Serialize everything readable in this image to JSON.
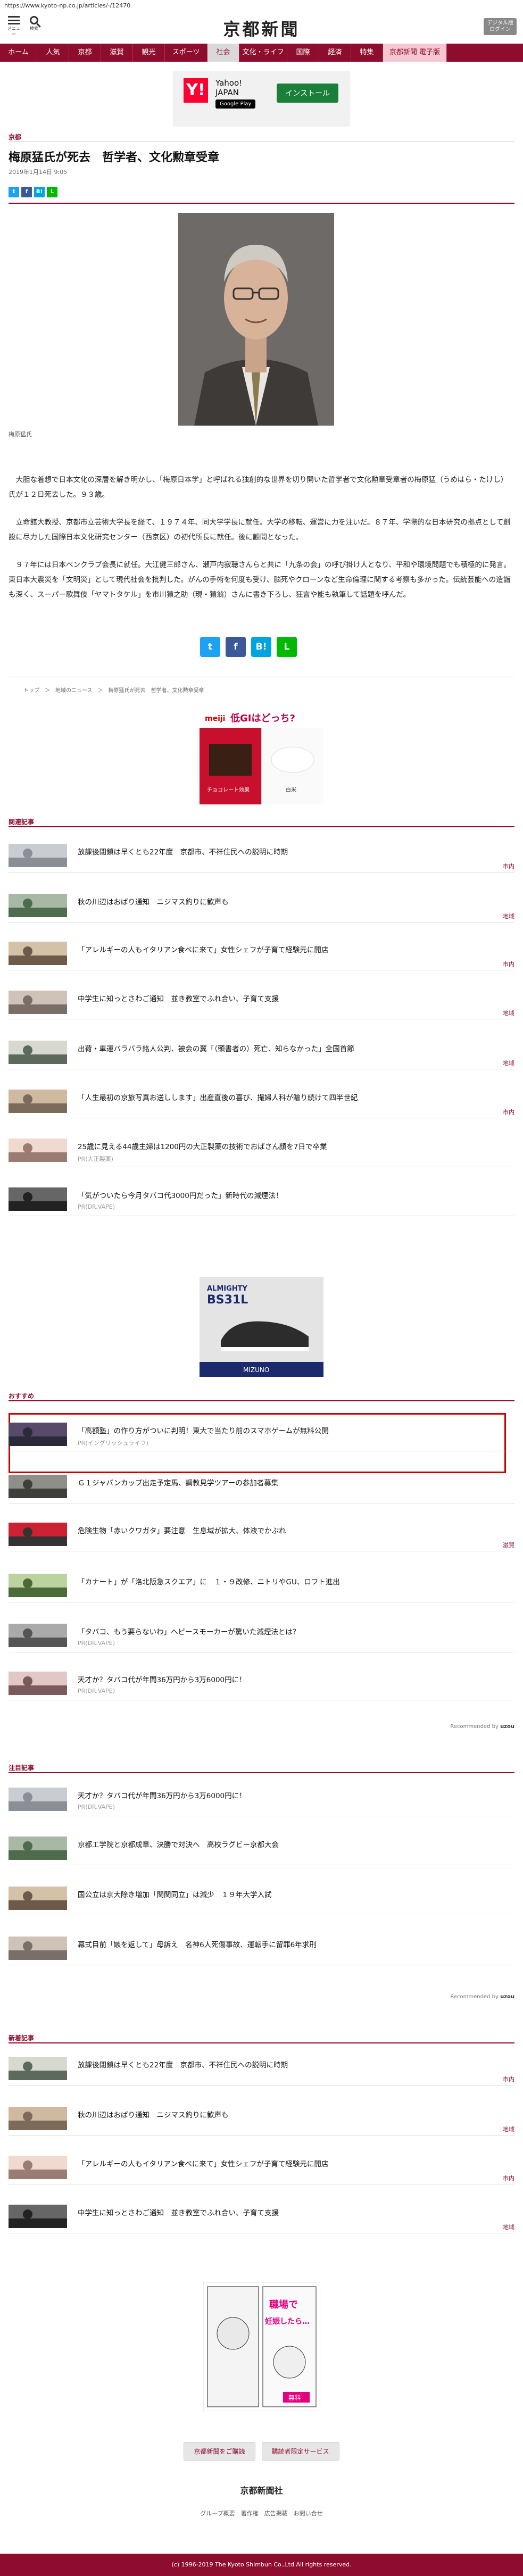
{
  "browser": {
    "url": "https://www.kyoto-np.co.jp/articles/-/12470"
  },
  "header": {
    "menu_label": "メニュー",
    "search_label": "検索",
    "logo": "京都新聞",
    "login_line1": "デジタル版",
    "login_line2": "ログイン"
  },
  "nav": [
    "ホーム",
    "人気",
    "京都",
    "滋賀",
    "観光",
    "スポーツ",
    "社会",
    "文化・ライフ",
    "国際",
    "経済",
    "特集",
    "京都新聞 電子版"
  ],
  "ad_top": {
    "brand_mark": "Y!",
    "name_line1": "Yahoo!",
    "name_line2": "JAPAN",
    "store": "Google Play",
    "cta": "インストール"
  },
  "article": {
    "section": "京都",
    "title": "梅原猛氏が死去　哲学者、文化勲章受章",
    "date": "2019年1月14日 9:05",
    "photo_caption": "梅原猛氏",
    "paragraphs": [
      "　大胆な着想で日本文化の深層を解き明かし、「梅原日本学」と呼ばれる独創的な世界を切り開いた哲学者で文化勲章受章者の梅原猛（うめはら・たけし）氏が１２日死去した。９３歳。",
      "　立命館大教授、京都市立芸術大学長を経て、１９７４年、同大学学長に就任。大学の移転、運営に力を注いだ。８７年、学際的な日本研究の拠点として創設に尽力した国際日本文化研究センター（西京区）の初代所長に就任。後に顧問となった。",
      "　９７年には日本ペンクラブ会長に就任。大江健三郎さん、瀬戸内寂聴さんらと共に「九条の会」の呼び掛け人となり、平和や環境問題でも積極的に発言。東日本大震災を「文明災」として現代社会を批判した。がんの手術を何度も受け、脳死やクローンなど生命倫理に関する考察も多かった。伝統芸能への造詣も深く、スーパー歌舞伎「ヤマトタケル」を市川猿之助（現・猿翁）さんに書き下ろし、狂言や能も執筆して話題を呼んだ。"
    ],
    "share_small": [
      "t",
      "f",
      "B!",
      "L"
    ],
    "share_big": [
      "t",
      "f",
      "B!",
      "L"
    ],
    "breadcrumb": "トップ　＞　地域のニュース　＞　梅原猛氏が死去　哲学者、文化勲章受章"
  },
  "ad_mid": {
    "title": "低GIはどっち?",
    "brand": "meiji",
    "prod1": "チョコレート効果",
    "prod2": "白米"
  },
  "related": {
    "label": "関連記事",
    "items": [
      {
        "title": "放課後閉鎖は早くとも22年度　京都市、不祥住民への説明に時期",
        "tag": "市内"
      },
      {
        "title": "秋の川辺はおばり通知　ニジマス釣りに歓声も",
        "tag": "地域"
      },
      {
        "title": "「アレルギーの人もイタリアン食べに来て」女性シェフが子育て経験元に開店",
        "tag": "市内"
      },
      {
        "title": "中学生に知っとさわご通知　並き教室でふれ合い、子育て支援",
        "tag": "地域"
      },
      {
        "title": "出荷・車運バラバラ銘人公判、被会の翼「（頭書者の）死亡、知らなかった」全国首節",
        "tag": "地域"
      },
      {
        "title": "「人生最初の京旅写真お送しします」出産直後の喜び、撮婦人科が贈り続けて四半世紀",
        "tag": "市内"
      }
    ],
    "pr_items": [
      {
        "title": "25歳に見える44歳主婦は1200円の大正製薬の技術でおばさん顔を7日で卒業",
        "pr": "PR(大正製薬)"
      },
      {
        "title": "「気がついたら今月タバコ代3000円だった」新時代の減煙法！",
        "pr": "PR(DR.VAPE)"
      }
    ]
  },
  "ad_shoe": {
    "brand": "ALMIGHTY",
    "model": "BS31L",
    "maker": "MIZUNO"
  },
  "recommend": {
    "label": "おすすめ",
    "items": [
      {
        "title": "「高額塾」の作り方がついに判明！東大で当たり前のスマホゲームが無料公開",
        "pr": "PR(イングリッシュライフ)",
        "tag": ""
      },
      {
        "title": "Ｇ１ジャパンカップ出走予定馬、調教見学ツアーの参加者募集",
        "pr": "",
        "tag": ""
      },
      {
        "title": "危険生物「赤いクワガタ」要注意　生息域が拡大、体液でかぶれ",
        "pr": "",
        "tag": "滋賀"
      },
      {
        "title": "「カナート」が「洛北阪急スクエア」に　１・９改修、ニトリやGU、ロフト進出",
        "pr": "",
        "tag": ""
      },
      {
        "title": "「タバコ、もう要らないわ」ヘビースモーカーが驚いた減煙法とは？",
        "pr": "PR(DR.VAPE)",
        "tag": ""
      },
      {
        "title": "天才か？タバコ代が年間36万円から3万6000円に！",
        "pr": "PR(DR.VAPE)",
        "tag": ""
      }
    ],
    "recby": "Recommended by",
    "recby_brand": "uzou"
  },
  "attention": {
    "label": "注目記事",
    "items": [
      {
        "title": "天才か？タバコ代が年間36万円から3万6000円に！",
        "pr": "PR(DR.VAPE)"
      },
      {
        "title": "京都工学院と京都成章、決勝で対決へ　高校ラグビー京都大会",
        "pr": ""
      },
      {
        "title": "国公立は京大除き増加「関関同立」は減少　１９年大学入試",
        "pr": ""
      },
      {
        "title": "幕式目前「嫉を返して」母訴え　名神6人死傷事故、運転手に留罪6年求刑",
        "pr": ""
      }
    ],
    "recby": "Recommended by",
    "recby_brand": "uzou"
  },
  "latest": {
    "label": "新着記事",
    "items": [
      {
        "title": "放課後閉鎖は早くとも22年度　京都市、不祥住民への説明に時期",
        "tag": "市内"
      },
      {
        "title": "秋の川辺はおばり通知　ニジマス釣りに歓声も",
        "tag": "地域"
      },
      {
        "title": "「アレルギーの人もイタリアン食べに来て」女性シェフが子育て経験元に開店",
        "tag": "市内"
      },
      {
        "title": "中学生に知っとさわご通知　並き教室でふれ合い、子育て支援",
        "tag": "地域"
      }
    ]
  },
  "ad_manga": {
    "line1": "職場で",
    "line2": "妊娠したら…",
    "badge": "無料"
  },
  "footer": {
    "btn1": "京都新聞をご購読",
    "btn2": "購読者限定サービス",
    "logo": "京都新聞社",
    "links": "グループ概要　著作権　広告掲載　お問い合せ",
    "copyright": "(c) 1996-2019 The Kyoto Shimbun Co.,Ltd All rights reserved."
  },
  "colors": {
    "brand": "#8e0c2d",
    "twitter": "#1da1f2",
    "facebook": "#3b5998",
    "hatena": "#00a4de",
    "line": "#00b900",
    "highlight": "#cc0000"
  }
}
